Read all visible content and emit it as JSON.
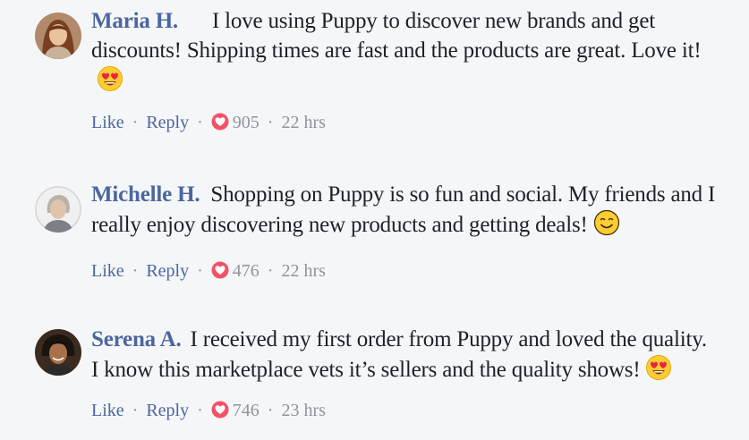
{
  "comments": [
    {
      "author": "Maria H.",
      "text": "I love using Puppy to discover new brands and get discounts! Shipping times are fast and the products are great. Love it!",
      "emoji": "heart-eyes-emoji-icon",
      "like_label": "Like",
      "reply_label": "Reply",
      "reaction_count": "905",
      "time": "22 hrs"
    },
    {
      "author": "Michelle H.",
      "text": "Shopping on Puppy is so fun and social. My friends and I really enjoy discovering new products and getting deals!",
      "emoji": "smiling-face-emoji-icon",
      "like_label": "Like",
      "reply_label": "Reply",
      "reaction_count": "476",
      "time": "22 hrs"
    },
    {
      "author": "Serena A.",
      "text": "I received my first order from Puppy and loved the quality. I know this marketplace vets it’s sellers and the quality shows!",
      "emoji": "heart-eyes-emoji-icon",
      "like_label": "Like",
      "reply_label": "Reply",
      "reaction_count": "746",
      "time": "23 hrs"
    }
  ],
  "separator": "·",
  "colors": {
    "author_link": "#4b67a1",
    "meta_gray": "#90949c",
    "text": "#1d2129",
    "background": "#f5f6f7",
    "love_reaction": "#f25268"
  }
}
